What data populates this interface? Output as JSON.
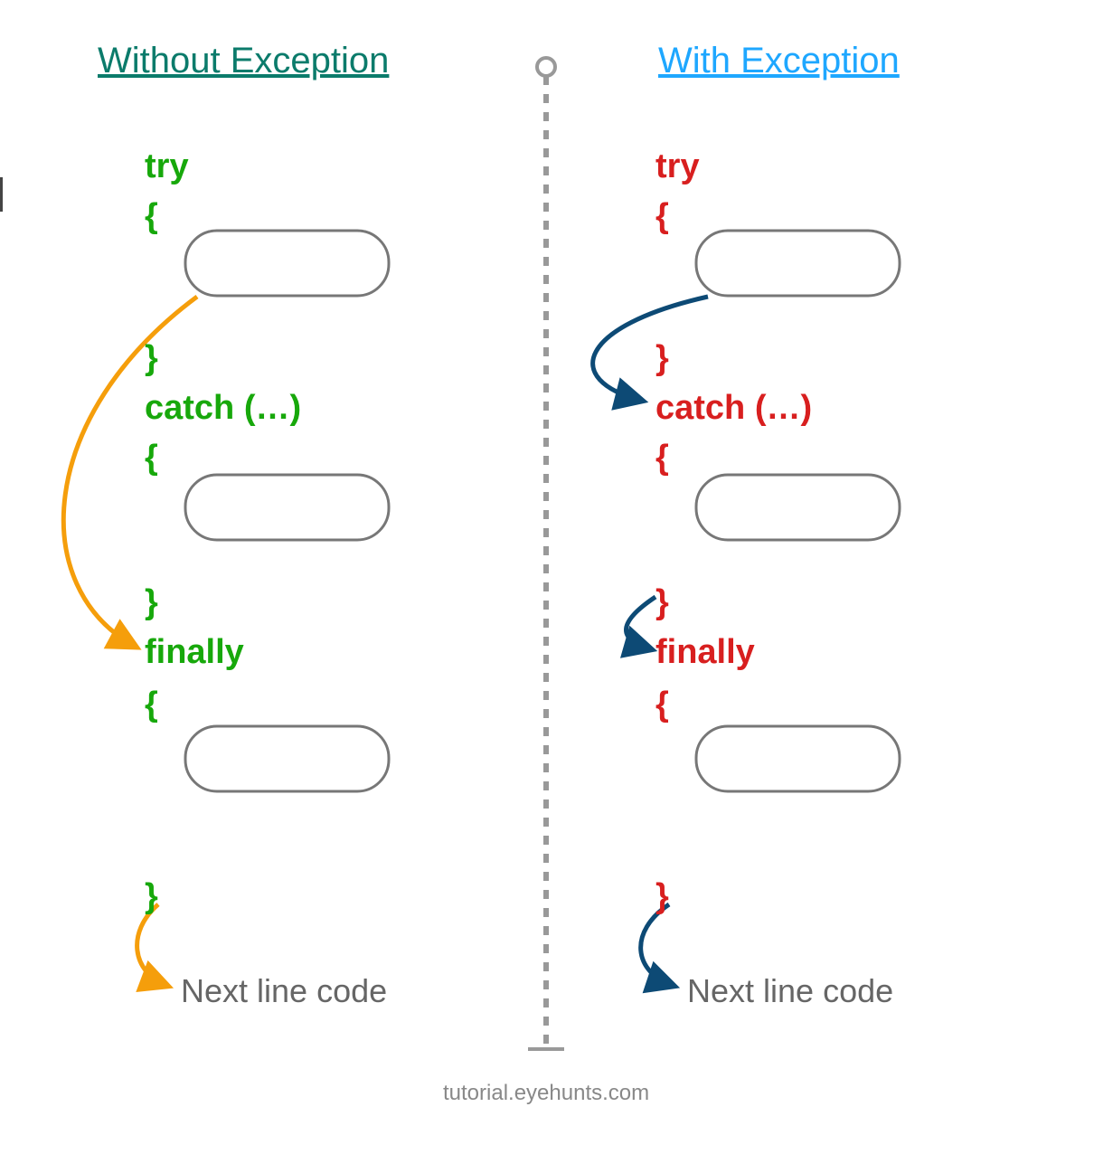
{
  "left": {
    "title": "Without Exception",
    "title_color": "#0b7b6b",
    "code_color": "#17a80b",
    "try": "try",
    "open1": "{",
    "close1": "}",
    "catch": "catch (…)",
    "open2": "{",
    "close2": "}",
    "finally": "finally",
    "open3": "{",
    "close3": "}",
    "next": "Next line code"
  },
  "right": {
    "title": "With Exception",
    "title_color": "#1ea7ff",
    "code_color": "#d81f1f",
    "try": "try",
    "open1": "{",
    "close1": "}",
    "catch": "catch (…)",
    "open2": "{",
    "close2": "}",
    "finally": "finally",
    "open3": "{",
    "close3": "}",
    "next": "Next line code"
  },
  "footer": "tutorial.eyehunts.com",
  "arrow_colors": {
    "left_main": "#F59E0B",
    "left_sub": "#F59E0B",
    "right_main": "#0d4a75",
    "right_sub": "#0d4a75"
  }
}
